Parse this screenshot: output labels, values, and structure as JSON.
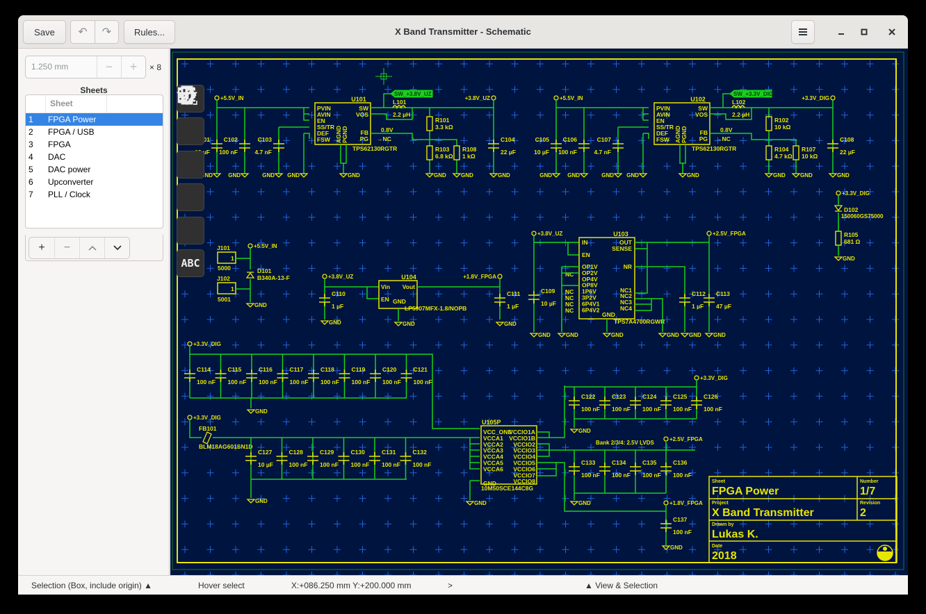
{
  "window": {
    "title": "X Band Transmitter - Schematic",
    "save_label": "Save",
    "rules_label": "Rules...",
    "undo_icon": "undo-icon",
    "redo_icon": "redo-icon",
    "menu_icon": "hamburger-menu-icon",
    "minimize_icon": "minimize-icon",
    "maximize_icon": "maximize-icon",
    "close_icon": "close-icon"
  },
  "sidebar": {
    "grid_spacing": "1.250 mm",
    "grid_multiplier": "× 8",
    "sheets_title": "Sheets",
    "sheet_column": "Sheet",
    "sheets": [
      {
        "num": "1",
        "name": "FPGA Power",
        "selected": true
      },
      {
        "num": "2",
        "name": "FPGA / USB"
      },
      {
        "num": "3",
        "name": "FPGA"
      },
      {
        "num": "4",
        "name": "DAC"
      },
      {
        "num": "5",
        "name": "DAC power"
      },
      {
        "num": "6",
        "name": "Upconverter"
      },
      {
        "num": "7",
        "name": "PLL / Clock"
      }
    ],
    "sheet_buttons": [
      "+",
      "−",
      "︿",
      "﹀"
    ]
  },
  "tools": [
    "place-symbol",
    "draw-net",
    "net-label",
    "power-symbol",
    "draw-line",
    "place-text"
  ],
  "tool_text_label": "ABC",
  "colors": {
    "canvas_bg": "#001440",
    "symbol": "#e6e600",
    "net": "#19d219",
    "grid": "#1e64dc",
    "selection_accent": "#3584e4"
  },
  "schematic": {
    "net_labels": {
      "sw_uz": "SW_+3.8V_UZ",
      "sw_dig": "SW_+3.3V_DIG"
    },
    "power": {
      "p55_in": "+5.5V_IN",
      "p38_uz": "+3.8V_UZ",
      "p33_dig": "+3.3V_DIG",
      "p18_fpga": "+1.8V_FPGA",
      "p25_fpga": "+2.5V_FPGA",
      "gnd": "GND"
    },
    "u101": {
      "ref": "U101",
      "part": "TPS62130RGTR",
      "left_pins": [
        "PVIN",
        "AVIN",
        "EN",
        "SS/TR",
        "DEF",
        "FSW"
      ],
      "right_pins": [
        "SW",
        "VOS",
        "FB",
        "PG"
      ],
      "bottom_pins": [
        "AGND",
        "PGND"
      ],
      "fb_voltage": "0.8V",
      "nc": "NC"
    },
    "u102": {
      "ref": "U102",
      "part": "TPS62130RGTR",
      "left_pins": [
        "PVIN",
        "AVIN",
        "EN",
        "SS/TR",
        "DEF",
        "FSW"
      ],
      "right_pins": [
        "SW",
        "VOS",
        "FB",
        "PG"
      ],
      "bottom_pins": [
        "AGND",
        "PGND"
      ],
      "fb_voltage": "0.8V",
      "nc": "NC"
    },
    "u103": {
      "ref": "U103",
      "part": "TPS7A4700RGWR",
      "left_pins": [
        "IN",
        "EN",
        "OP1V",
        "OP2V",
        "OP4V",
        "OP8V",
        "1P6V",
        "3P2V",
        "6P4V1",
        "6P4V2"
      ],
      "right_pins": [
        "OUT",
        "SENSE",
        "NR",
        "NC1",
        "NC2",
        "NC3",
        "NC4"
      ],
      "gnd": "GND",
      "nc": "NC"
    },
    "u104": {
      "ref": "U104",
      "part": "LP5907MFX-1.8/NOPB",
      "pins": [
        "Vin",
        "EN",
        "Vout",
        "GND"
      ]
    },
    "u105": {
      "ref": "U105P",
      "part": "10M50SCE144C8G",
      "left_pins": [
        "VCC_ONE",
        "VCCA1",
        "VCCA2",
        "VCCA3",
        "VCCA4",
        "VCCA5",
        "VCCA6",
        "GND"
      ],
      "right_pins": [
        "VCCIO1A",
        "VCCIO1B",
        "VCCIO2",
        "VCCIO3",
        "VCCIO4",
        "VCCIO5",
        "VCCIO6",
        "VCCIO7",
        "VCCIO8"
      ]
    },
    "bank_note": "Bank 2/3/4: 2.5V LVDS",
    "passives": {
      "C101": "10 µF",
      "C102": "100 nF",
      "C103": "4.7 nF",
      "C104": "22 µF",
      "C105": "10 µF",
      "C106": "100 nF",
      "C107": "4.7 nF",
      "C108": "22 µF",
      "C109": "10 µF",
      "C110": "1 µF",
      "C111": "1 µF",
      "C112": "1 µF",
      "C113": "47 µF",
      "C114": "100 nF",
      "C115": "100 nF",
      "C116": "100 nF",
      "C117": "100 nF",
      "C118": "100 nF",
      "C119": "100 nF",
      "C120": "100 nF",
      "C121": "100 nF",
      "C122": "100 nF",
      "C123": "100 nF",
      "C124": "100 nF",
      "C125": "100 nF",
      "C126": "100 nF",
      "C127": "10 µF",
      "C128": "100 nF",
      "C129": "100 nF",
      "C130": "100 nF",
      "C131": "100 nF",
      "C132": "100 nF",
      "C133": "100 nF",
      "C134": "100 nF",
      "C135": "100 nF",
      "C136": "100 nF",
      "C137": "100 nF",
      "L101": "2.2 µH",
      "L102": "2.2 µH",
      "R101": "3.3 kΩ",
      "R102": "10 kΩ",
      "R103": "6.8 kΩ",
      "R104": "4.7 kΩ",
      "R105": "681 Ω",
      "R107": "10 kΩ",
      "R108": "1 kΩ"
    },
    "j101": {
      "ref": "J101",
      "value": "5000",
      "pin": "1"
    },
    "j102": {
      "ref": "J102",
      "value": "5001",
      "pin": "1"
    },
    "d101": {
      "ref": "D101",
      "part": "B340A-13-F"
    },
    "d102": {
      "ref": "D102",
      "part": "150060GS75000"
    },
    "fb101": {
      "ref": "FB101",
      "part": "BLM18AG601SN1D"
    }
  },
  "title_block": {
    "sheet_label": "Sheet",
    "sheet": "FPGA Power",
    "number_label": "Number",
    "number": "1/7",
    "project_label": "Project",
    "project": "X Band Transmitter",
    "revision_label": "Revision",
    "revision": "2",
    "drawn_label": "Drawn by",
    "drawn": "Lukas K.",
    "date_label": "Date",
    "date": "2018"
  },
  "statusbar": {
    "selection_mode": "Selection (Box, include origin) ▲",
    "hover": "Hover select",
    "coords": "X:+086.250 mm Y:+200.000 mm",
    "arrow": ">",
    "view": "▲ View & Selection"
  }
}
